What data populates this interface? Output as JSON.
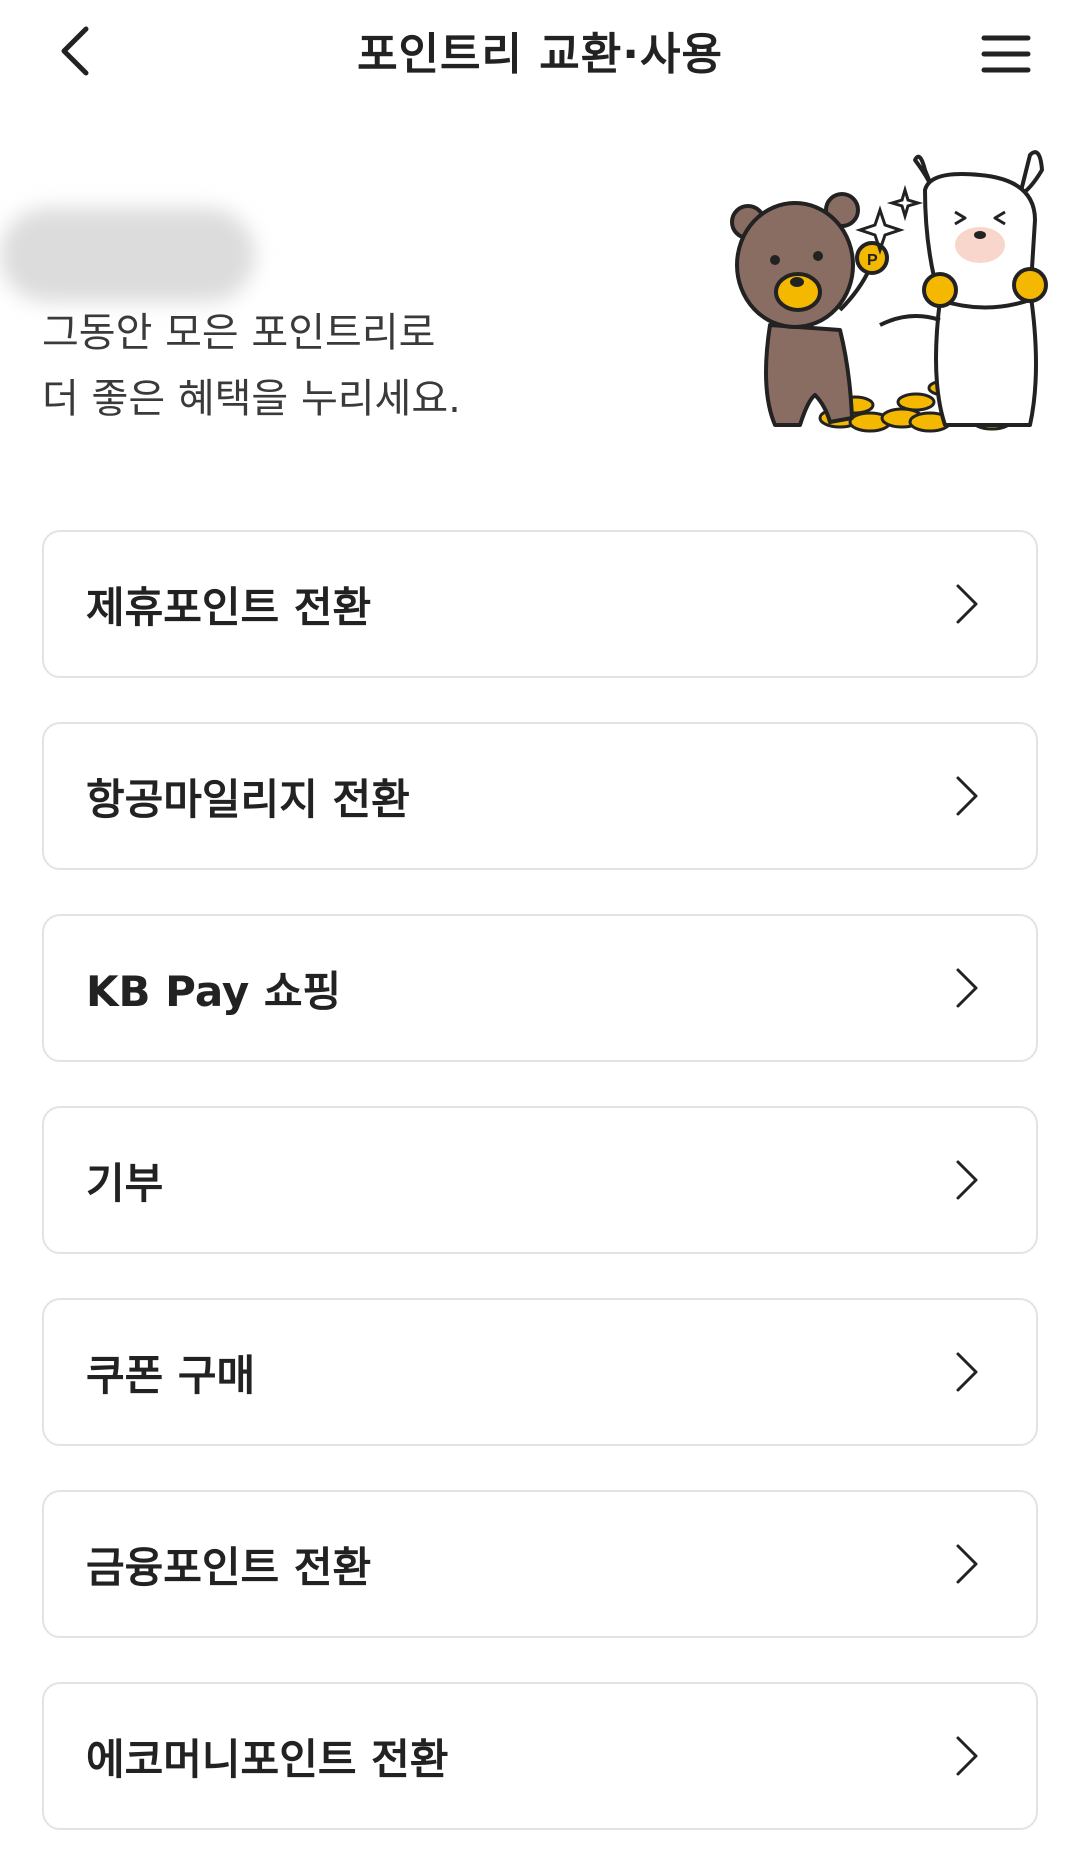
{
  "header": {
    "title": "포인트리 교환·사용",
    "back_icon": "chevron-left-icon",
    "menu_icon": "hamburger-menu-icon"
  },
  "hero": {
    "line1": "그동안 모은 포인트리로",
    "line2": "더 좋은 혜택을 누리세요.",
    "illustration": "bear-and-alpaca-with-coins"
  },
  "menu": {
    "items": [
      {
        "label": "제휴포인트 전환"
      },
      {
        "label": "항공마일리지 전환"
      },
      {
        "label": "KB Pay 쇼핑"
      },
      {
        "label": "기부"
      },
      {
        "label": "쿠폰 구매"
      },
      {
        "label": "금융포인트 전환"
      },
      {
        "label": "에코머니포인트 전환"
      }
    ],
    "chevron_icon": "chevron-right-icon"
  },
  "colors": {
    "card_border": "#e3e3e3",
    "text": "#222222",
    "coin_gold": "#f5b800"
  }
}
